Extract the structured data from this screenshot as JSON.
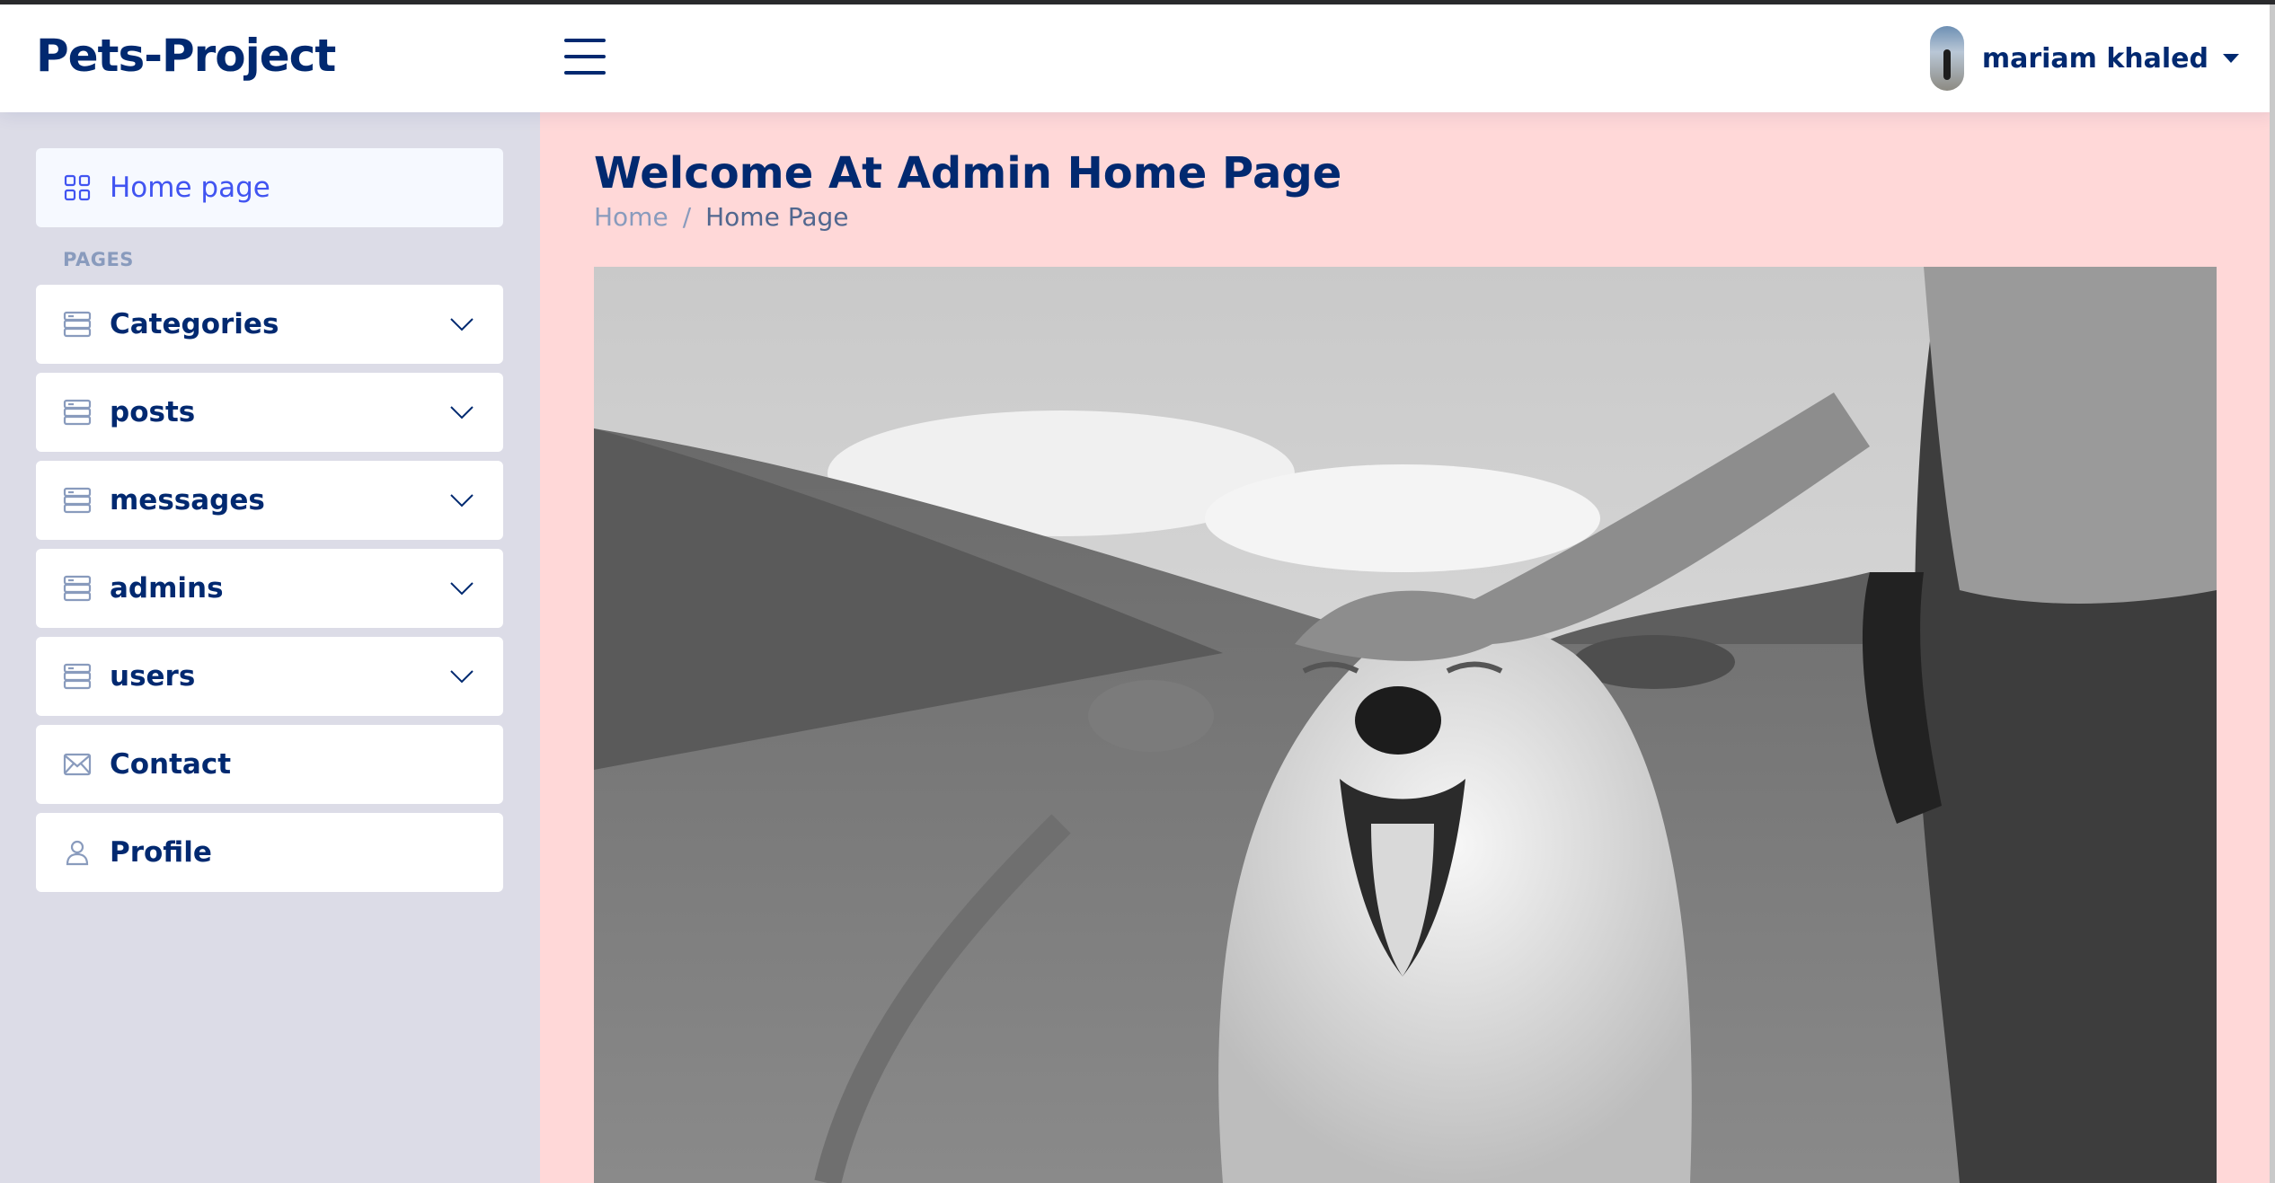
{
  "header": {
    "logo": "Pets-Project",
    "user_name": "mariam khaled",
    "menu_icon": "hamburger-icon",
    "dropdown_icon": "caret-down-icon"
  },
  "sidebar": {
    "home": {
      "label": "Home page",
      "icon": "grid-icon"
    },
    "pages_heading": "PAGES",
    "items": [
      {
        "label": "Categories",
        "icon": "layout-icon",
        "expandable": true
      },
      {
        "label": "posts",
        "icon": "layout-icon",
        "expandable": true
      },
      {
        "label": "messages",
        "icon": "layout-icon",
        "expandable": true
      },
      {
        "label": "admins",
        "icon": "layout-icon",
        "expandable": true
      },
      {
        "label": "users",
        "icon": "layout-icon",
        "expandable": true
      },
      {
        "label": "Contact",
        "icon": "envelope-icon",
        "expandable": false
      },
      {
        "label": "Profile",
        "icon": "person-icon",
        "expandable": false
      }
    ]
  },
  "main": {
    "title": "Welcome At Admin Home Page",
    "breadcrumb": {
      "home": "Home",
      "separator": "/",
      "current": "Home Page"
    },
    "hero_image": "black-and-white photo of a person patting a yawning white dog on a grassy hillside"
  },
  "colors": {
    "brand": "#012970",
    "active": "#4154f1",
    "sidebar_bg": "#dcdce7",
    "main_bg": "#ffd8d8"
  }
}
